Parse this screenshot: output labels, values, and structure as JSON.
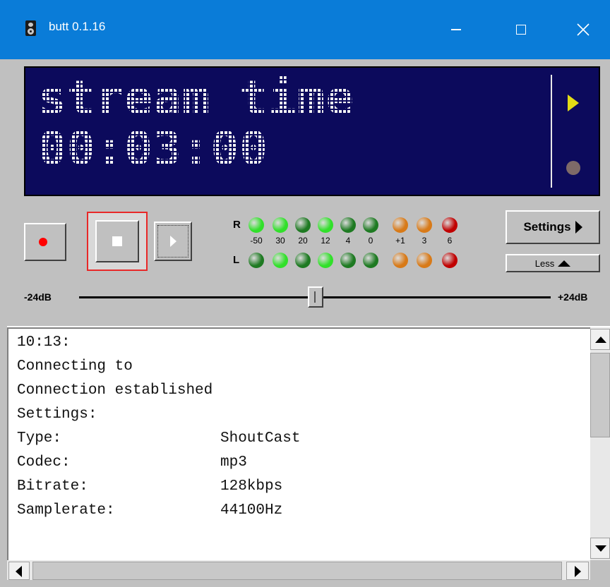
{
  "window": {
    "title": "butt 0.1.16",
    "icon": "speaker-icon",
    "controls": [
      "minimize-icon",
      "maximize-icon",
      "close-icon"
    ]
  },
  "display": {
    "line1": "stream time",
    "line2": "00:03:00",
    "bg_color": "#0c0a5c",
    "text_color": "#f4f4f4",
    "stream_indicator": "play-triangle-icon",
    "record_indicator": "record-dot-icon"
  },
  "controls": {
    "record_button": "record-icon",
    "stop_button": "stop-icon",
    "play_button": "play-icon",
    "settings_label": "Settings",
    "less_label": "Less"
  },
  "vu_meter": {
    "right_label": "R",
    "left_label": "L",
    "scale": [
      "-50",
      "30",
      "20",
      "12",
      "4",
      "0",
      "+1",
      "3",
      "6"
    ],
    "right_leds": [
      "#31e02a",
      "#31e02a",
      "#1e7a22",
      "#31e02a",
      "#1e7a22",
      "#1e7a22",
      "#d87a18",
      "#d87a18",
      "#c00000"
    ],
    "left_leds": [
      "#1e7a22",
      "#31e02a",
      "#1e7a22",
      "#31e02a",
      "#1e7a22",
      "#1e7a22",
      "#d87a18",
      "#d87a18",
      "#c00000"
    ]
  },
  "volume": {
    "min_label": "-24dB",
    "max_label": "+24dB",
    "value_db": 0
  },
  "log": {
    "lines": [
      "10:13:",
      "Connecting to",
      "Connection established",
      "Settings:"
    ],
    "settings": [
      {
        "key": "Type:",
        "value": "ShoutCast"
      },
      {
        "key": "Codec:",
        "value": "mp3"
      },
      {
        "key": "Bitrate:",
        "value": "128kbps"
      },
      {
        "key": "Samplerate:",
        "value": "44100Hz"
      }
    ]
  }
}
